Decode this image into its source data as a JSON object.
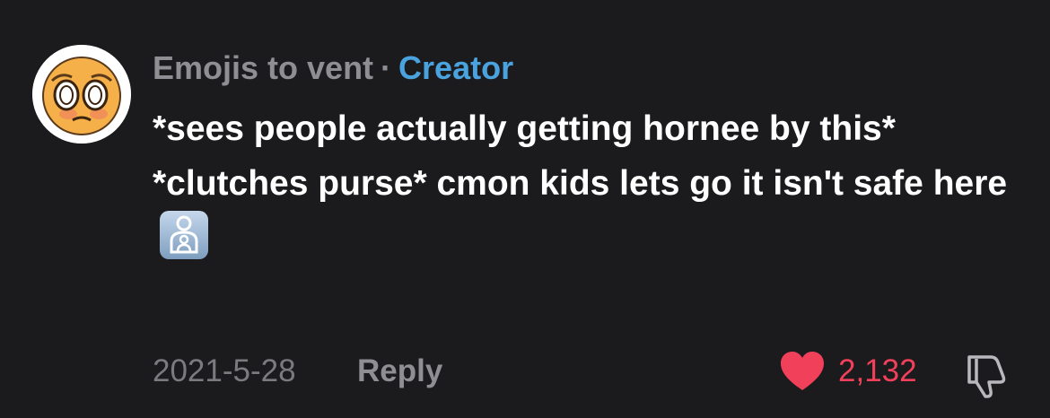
{
  "comment": {
    "author": "Emojis to vent",
    "separator": "·",
    "badge": "Creator",
    "text_lines": [
      "*sees people actually getting hornee by this*",
      "*clutches purse* cmon kids lets go it isn't safe here"
    ],
    "inline_emoji": "person-with-child-emoji",
    "date": "2021-5-28",
    "reply_label": "Reply",
    "like_count": "2,132",
    "liked": true,
    "colors": {
      "background": "#1b1b1d",
      "author": "#8e8e93",
      "creator": "#4aa3df",
      "text": "#ffffff",
      "like": "#f0405a"
    }
  }
}
